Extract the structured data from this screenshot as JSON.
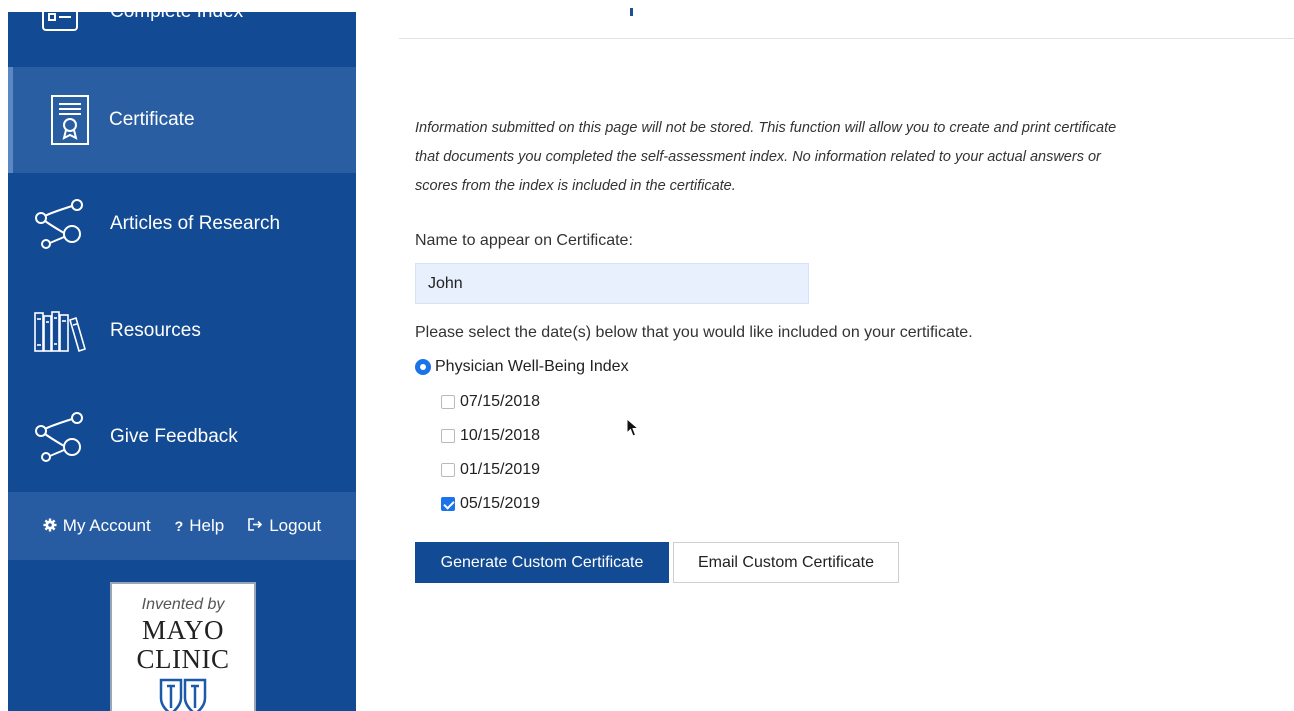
{
  "sidebar": {
    "items": [
      {
        "label": "Complete Index",
        "icon": "checklist-icon"
      },
      {
        "label": "Certificate",
        "icon": "certificate-icon",
        "active": true
      },
      {
        "label": "Articles of Research",
        "icon": "share-nodes-icon"
      },
      {
        "label": "Resources",
        "icon": "books-icon"
      },
      {
        "label": "Give Feedback",
        "icon": "share-nodes-icon"
      }
    ],
    "account": {
      "my_account": "My Account",
      "help": "Help",
      "logout": "Logout",
      "help_glyph": "?"
    },
    "logo": {
      "invented_by": "Invented by",
      "line1": "MAYO",
      "line2": "CLINIC"
    }
  },
  "main": {
    "info_text": "Information submitted on this page will not be stored. This function will allow you to create and print certificate that documents you completed the self-assessment index. No information related to your actual answers or scores from the index is included in the certificate.",
    "name_label": "Name to appear on Certificate:",
    "name_value": "John",
    "dates_prompt": "Please select the date(s) below that you would like included on your certificate.",
    "index_option": "Physician Well-Being Index",
    "dates": [
      {
        "label": "07/15/2018",
        "checked": false
      },
      {
        "label": "10/15/2018",
        "checked": false
      },
      {
        "label": "01/15/2019",
        "checked": false
      },
      {
        "label": "05/15/2019",
        "checked": true
      }
    ],
    "generate_button": "Generate Custom Certificate",
    "email_button": "Email Custom Certificate"
  },
  "colors": {
    "sidebar": "#124a93",
    "sidebar_active": "#2a5ea3",
    "accent": "#1a73e8",
    "input_bg": "#e8f0fe"
  }
}
